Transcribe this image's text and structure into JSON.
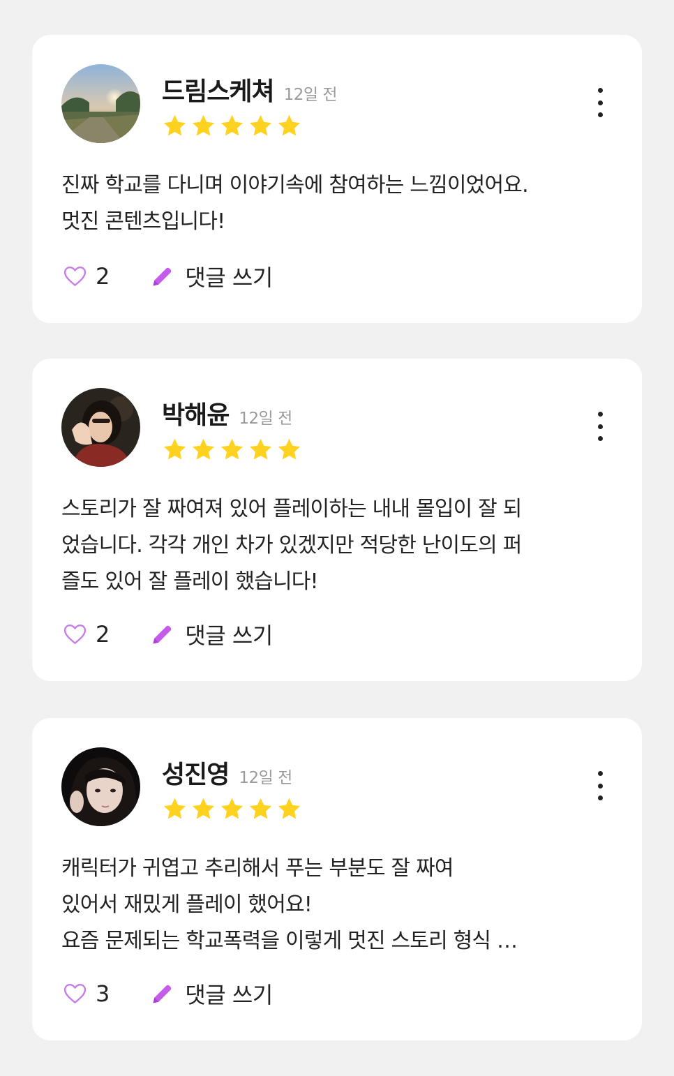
{
  "reviews": [
    {
      "author": "드림스케쳐",
      "time_ago": "12일 전",
      "rating": 5,
      "text_lines": [
        "진짜 학교를 다니며 이야기속에 참여하는 느낌이었어요.",
        "멋진 콘텐츠입니다!"
      ],
      "likes": "2",
      "comment_label": "댓글 쓰기"
    },
    {
      "author": "박해윤",
      "time_ago": "12일 전",
      "rating": 5,
      "text_lines": [
        "스토리가 잘 짜여져 있어 플레이하는 내내 몰입이 잘 되",
        "었습니다. 각각 개인 차가 있겠지만 적당한 난이도의 퍼",
        "즐도 있어 잘 플레이 했습니다!"
      ],
      "likes": "2",
      "comment_label": "댓글 쓰기"
    },
    {
      "author": "성진영",
      "time_ago": "12일 전",
      "rating": 5,
      "text_lines": [
        "캐릭터가 귀엽고 추리해서 푸는 부분도 잘 짜여",
        "있어서 재밌게 플레이 했어요!",
        "요즘 문제되는 학교폭력을 이렇게 멋진 스토리 형식 …"
      ],
      "likes": "3",
      "comment_label": "댓글 쓰기"
    }
  ],
  "colors": {
    "star": "#FFD21F",
    "heart_outline": "#C77DE8",
    "pencil": "#C45BEA",
    "card_bg": "#FFFFFF",
    "page_bg": "#F1F1F2"
  },
  "icons": [
    "star-icon",
    "heart-outline-icon",
    "pencil-icon",
    "more-vertical-icon"
  ]
}
